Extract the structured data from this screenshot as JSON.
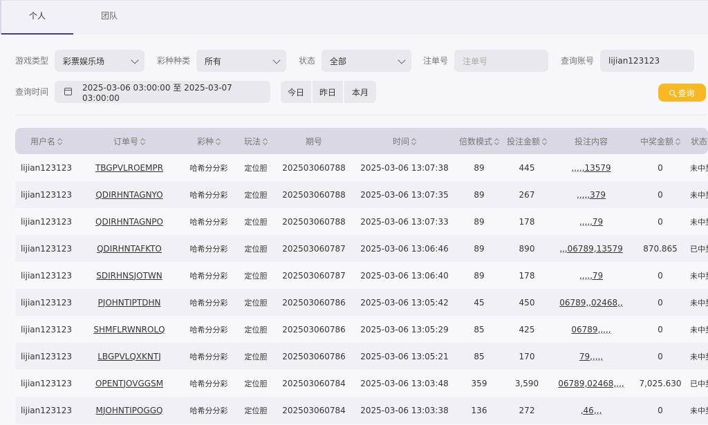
{
  "tabs": [
    "个人",
    "团队"
  ],
  "filters": {
    "game_type_label": "游戏类型",
    "game_type_value": "彩票娱乐场",
    "lottery_kind_label": "彩种种类",
    "lottery_kind_value": "所有",
    "status_label": "状态",
    "status_value": "全部",
    "order_no_label": "注单号",
    "order_no_placeholder": "注单号",
    "account_label": "查询账号",
    "account_value": "lijian123123",
    "time_label": "查询时间",
    "time_range": "2025-03-06 03:00:00 至 2025-03-07 03:00:00",
    "quick": [
      "今日",
      "昨日",
      "本月"
    ],
    "search_label": "查询"
  },
  "table": {
    "headers": [
      "用户名",
      "订单号",
      "彩种",
      "玩法",
      "期号",
      "时间",
      "倍数模式",
      "投注金额",
      "投注内容",
      "中奖金额",
      "状态"
    ],
    "rows": [
      [
        "lijian123123",
        "TBGPVLROEMPR",
        "哈希分分彩",
        "定位胆",
        "202503060788",
        "2025-03-06 13:07:38",
        "89",
        "445",
        ",,,,,13579",
        "0",
        "未中奖"
      ],
      [
        "lijian123123",
        "QDIRHNTAGNYO",
        "哈希分分彩",
        "定位胆",
        "202503060788",
        "2025-03-06 13:07:35",
        "89",
        "267",
        ",,,,,379",
        "0",
        "未中奖"
      ],
      [
        "lijian123123",
        "QDIRHNTAGNPO",
        "哈希分分彩",
        "定位胆",
        "202503060788",
        "2025-03-06 13:07:33",
        "89",
        "178",
        ",,,,,79",
        "0",
        "未中奖"
      ],
      [
        "lijian123123",
        "QDIRHNTAFKTO",
        "哈希分分彩",
        "定位胆",
        "202503060787",
        "2025-03-06 13:06:46",
        "89",
        "890",
        ",,,06789,13579",
        "870.865",
        "已中奖"
      ],
      [
        "lijian123123",
        "SDIRHNSJOTWN",
        "哈希分分彩",
        "定位胆",
        "202503060787",
        "2025-03-06 13:06:40",
        "89",
        "178",
        ",,,,,79",
        "0",
        "未中奖"
      ],
      [
        "lijian123123",
        "PJOHNTIPTDHN",
        "哈希分分彩",
        "定位胆",
        "202503060786",
        "2025-03-06 13:05:42",
        "45",
        "450",
        "06789,,02468,,",
        "0",
        "未中奖"
      ],
      [
        "lijian123123",
        "SHMFLRWNROLQ",
        "哈希分分彩",
        "定位胆",
        "202503060786",
        "2025-03-06 13:05:29",
        "85",
        "425",
        "06789,,,,,",
        "0",
        "未中奖"
      ],
      [
        "lijian123123",
        "LBGPVLQXKNTJ",
        "哈希分分彩",
        "定位胆",
        "202503060786",
        "2025-03-06 13:05:21",
        "85",
        "170",
        "79,,,,,",
        "0",
        "未中奖"
      ],
      [
        "lijian123123",
        "OPENTJOVGGSM",
        "哈希分分彩",
        "定位胆",
        "202503060784",
        "2025-03-06 13:03:48",
        "359",
        "3,590",
        "06789,02468,,,,",
        "7,025.630",
        "已中奖"
      ],
      [
        "lijian123123",
        "MJOHNTIPOGGQ",
        "哈希分分彩",
        "定位胆",
        "202503060784",
        "2025-03-06 13:03:38",
        "136",
        "272",
        ",46,,,",
        "0",
        "未中奖"
      ]
    ]
  }
}
